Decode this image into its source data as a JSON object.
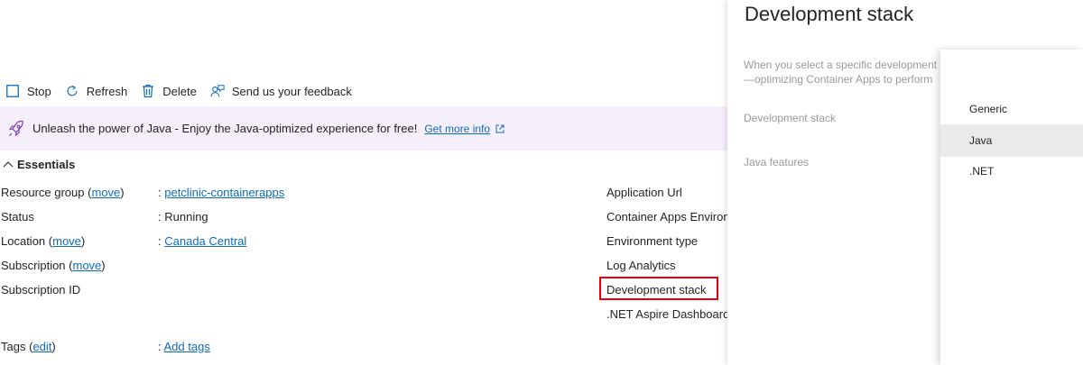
{
  "toolbar": {
    "stop": "Stop",
    "refresh": "Refresh",
    "delete": "Delete",
    "feedback": "Send us your feedback"
  },
  "banner": {
    "text": "Unleash the power of Java - Enjoy the Java-optimized experience for free!",
    "link": "Get more info"
  },
  "essentials": {
    "heading": "Essentials",
    "left": [
      {
        "key": "Resource group",
        "key_link": "move",
        "value": "petclinic-containerapps",
        "value_is_link": true
      },
      {
        "key": "Status",
        "value": "Running",
        "value_is_link": false
      },
      {
        "key": "Location",
        "key_link": "move",
        "value": "Canada Central",
        "value_is_link": true
      },
      {
        "key": "Subscription",
        "key_link": "move",
        "value": "",
        "value_is_link": false
      },
      {
        "key": "Subscription ID",
        "value": "",
        "value_is_link": false
      },
      {
        "key": "Tags",
        "key_link": "edit",
        "value": "Add tags",
        "value_is_link": true
      }
    ],
    "right": [
      "Application Url",
      "Container Apps Environment",
      "Environment type",
      "Log Analytics",
      "Development stack",
      ".NET Aspire Dashboard"
    ]
  },
  "panel": {
    "title": "Development stack",
    "description_line1": "When you select a specific development stack",
    "description_line2": "—optimizing Container Apps to perform",
    "label_stack": "Development stack",
    "label_java": "Java features"
  },
  "dropdown": {
    "options": [
      "Generic",
      "Java",
      ".NET"
    ],
    "selected": "Java"
  },
  "colors": {
    "link": "#0f6cbd",
    "banner_bg": "#f5eefb",
    "highlight": "#e3000f",
    "selected_option_bg": "#ebebeb"
  }
}
